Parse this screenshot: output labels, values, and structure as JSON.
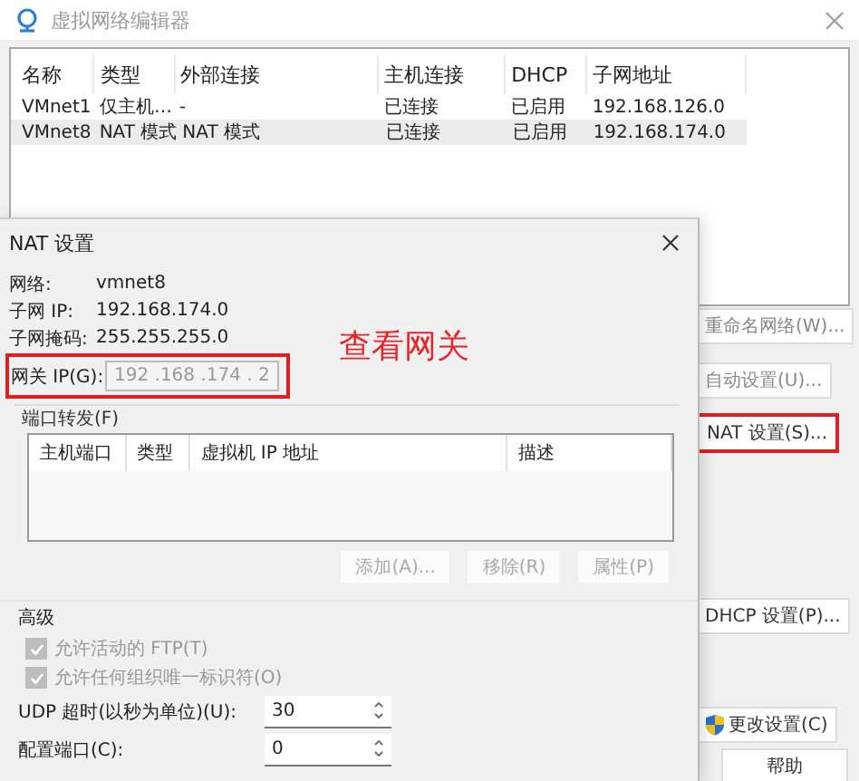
{
  "window": {
    "title": "虚拟网络编辑器"
  },
  "networks": {
    "columns": [
      "名称",
      "类型",
      "外部连接",
      "主机连接",
      "DHCP",
      "子网地址"
    ],
    "rows": [
      {
        "cells": [
          "VMnet1",
          "仅主机…",
          "-",
          "已连接",
          "已启用",
          "192.168.126.0"
        ],
        "selected": false
      },
      {
        "cells": [
          "VMnet8",
          "NAT 模式",
          "NAT 模式",
          "已连接",
          "已启用",
          "192.168.174.0"
        ],
        "selected": true
      }
    ]
  },
  "side_buttons": [
    {
      "label": "重命名网络(W)...",
      "annotated": false
    },
    {
      "label": "自动设置(U)...",
      "annotated": false
    },
    {
      "label": "NAT 设置(S)...",
      "annotated": true
    },
    {
      "label": "DHCP 设置(P)...",
      "annotated": false
    },
    {
      "label": "更改设置(C)",
      "annotated": false,
      "kind": "shield"
    },
    {
      "label": "帮助",
      "annotated": false
    }
  ],
  "nat_dialog": {
    "title": "NAT 设置",
    "info": [
      {
        "label": "网络:",
        "value": "vmnet8"
      },
      {
        "label": "子网 IP:",
        "value": "192.168.174.0"
      },
      {
        "label": "子网掩码:",
        "value": "255.255.255.0"
      }
    ],
    "gateway": {
      "label": "网关 IP(G):",
      "value": "192 .168 .174 . 2",
      "annotated": true
    },
    "annotation": "查看网关",
    "port_forwarding": {
      "label": "端口转发(F)",
      "columns": [
        "主机端口",
        "类型",
        "虚拟机 IP 地址",
        "描述"
      ],
      "buttons": [
        {
          "label": "添加(A)...",
          "disabled": true
        },
        {
          "label": "移除(R)",
          "disabled": true
        },
        {
          "label": "属性(P)",
          "disabled": true
        }
      ]
    },
    "advanced": {
      "label": "高级",
      "checkboxes": [
        {
          "label": "允许活动的 FTP(T)",
          "checked": true,
          "disabled": true
        },
        {
          "label": "允许任何组织唯一标识符(O)",
          "checked": true,
          "disabled": true
        }
      ],
      "spinners": [
        {
          "label": "UDP 超时(以秒为单位)(U):",
          "value": "30"
        },
        {
          "label": "配置端口(C):",
          "value": "0"
        }
      ]
    }
  }
}
